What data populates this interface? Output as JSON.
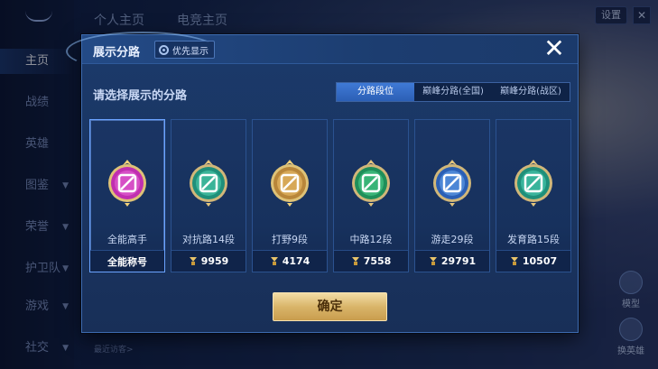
{
  "background": {
    "top_tabs": [
      "个人主页",
      "电竞主页"
    ],
    "nav": [
      {
        "label": "主页",
        "active": true,
        "arrow": false
      },
      {
        "label": "战绩",
        "active": false,
        "arrow": false
      },
      {
        "label": "英雄",
        "active": false,
        "arrow": false
      },
      {
        "label": "图鉴",
        "active": false,
        "arrow": true
      },
      {
        "label": "荣誉",
        "active": false,
        "arrow": true
      },
      {
        "label": "护卫队",
        "active": false,
        "arrow": true
      },
      {
        "label": "游戏",
        "active": false,
        "arrow": true
      },
      {
        "label": "社交",
        "active": false,
        "arrow": true
      }
    ],
    "settings_label": "设置",
    "close_label": "✕",
    "side_buttons": [
      "模型",
      "换英雄"
    ],
    "recent_visitors": "最近访客>"
  },
  "modal": {
    "title": "展示分路",
    "priority_label": "优先显示",
    "close_glyph": "✕",
    "subtitle": "请选择展示的分路",
    "segments": [
      {
        "label": "分路段位",
        "active": true
      },
      {
        "label": "巅峰分路(全国)",
        "active": false
      },
      {
        "label": "巅峰分路(战区)",
        "active": false
      }
    ],
    "cards": [
      {
        "name": "全能高手",
        "foot": "全能称号",
        "has_coin": false,
        "badge": "allround-badge-icon",
        "colors": [
          "#c02fb0",
          "#e86ad8",
          "#f4d27a"
        ]
      },
      {
        "name": "对抗路14段",
        "foot": "9959",
        "has_coin": true,
        "badge": "clash-lane-badge-icon",
        "colors": [
          "#1f8f7a",
          "#52d3b3",
          "#e5c57c"
        ]
      },
      {
        "name": "打野9段",
        "foot": "4174",
        "has_coin": true,
        "badge": "jungle-badge-icon",
        "colors": [
          "#b8863a",
          "#f0c470",
          "#f4d27a"
        ]
      },
      {
        "name": "中路12段",
        "foot": "7558",
        "has_coin": true,
        "badge": "mid-lane-badge-icon",
        "colors": [
          "#1f8f5a",
          "#4fd38f",
          "#e5c57c"
        ]
      },
      {
        "name": "游走29段",
        "foot": "29791",
        "has_coin": true,
        "badge": "roam-badge-icon",
        "colors": [
          "#2b5fb5",
          "#69a7f0",
          "#e5c57c"
        ]
      },
      {
        "name": "发育路15段",
        "foot": "10507",
        "has_coin": true,
        "badge": "farm-lane-badge-icon",
        "colors": [
          "#1f8f7a",
          "#4fd3b8",
          "#e5c57c"
        ]
      }
    ],
    "confirm_label": "确定"
  }
}
